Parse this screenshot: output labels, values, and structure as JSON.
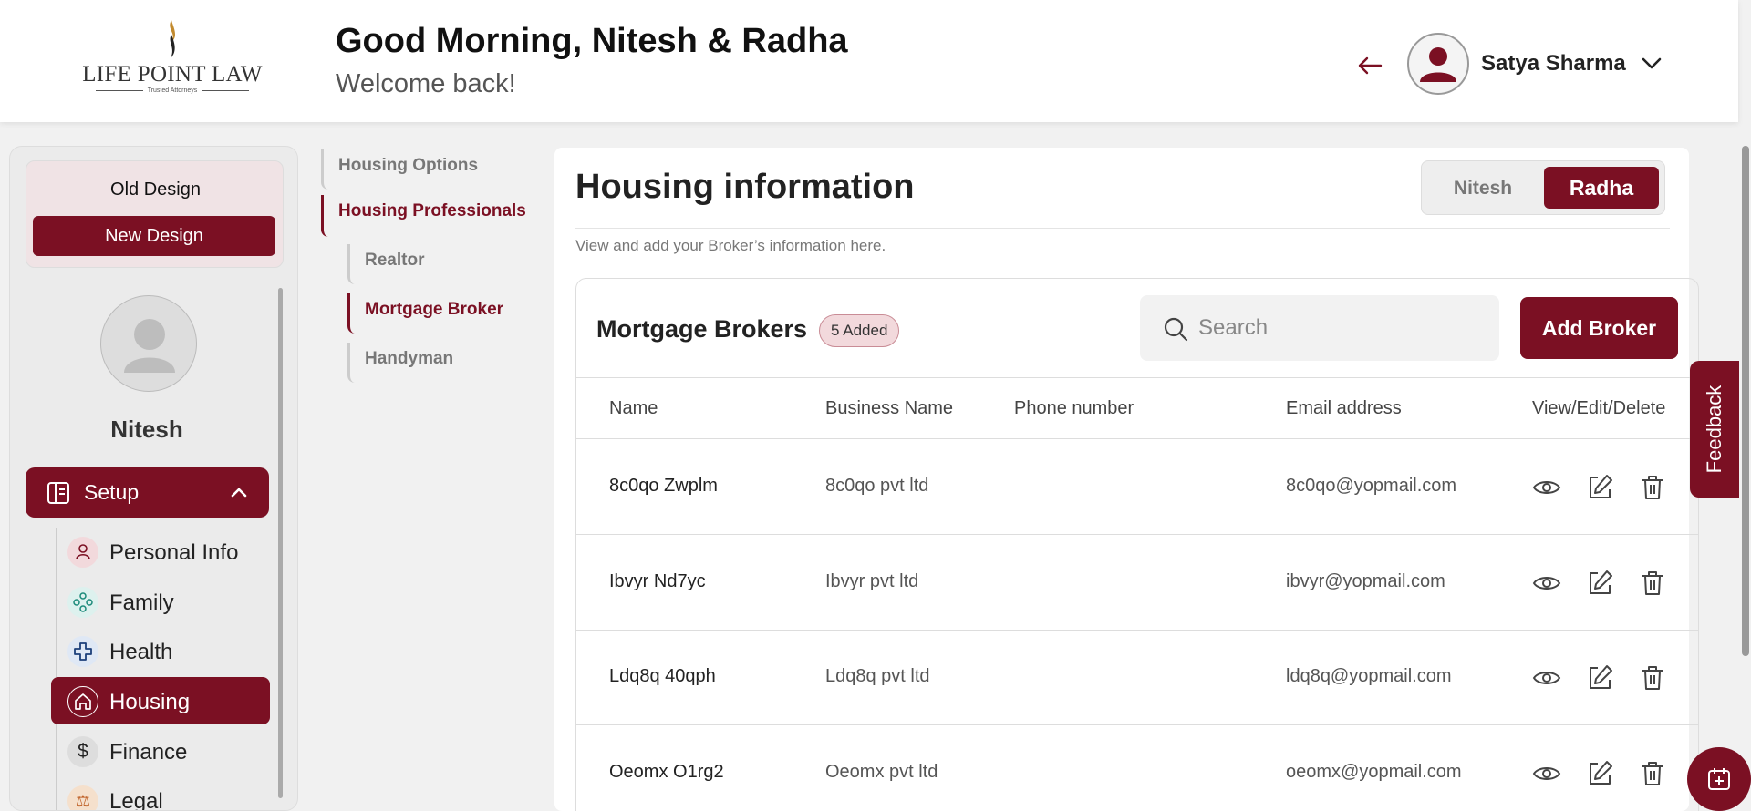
{
  "header": {
    "logo_text": "LIFE POINT LAW",
    "logo_sub": "Trusted Attorneys",
    "greeting": "Good Morning, Nitesh & Radha",
    "welcome": "Welcome back!",
    "user_name": "Satya Sharma"
  },
  "sidebar": {
    "old_design": "Old Design",
    "new_design": "New Design",
    "profile_name": "Nitesh",
    "setup_label": "Setup",
    "items": [
      {
        "label": "Personal Info",
        "icon": "person-icon"
      },
      {
        "label": "Family",
        "icon": "family-icon"
      },
      {
        "label": "Health",
        "icon": "health-cross-icon"
      },
      {
        "label": "Housing",
        "icon": "house-icon",
        "active": true
      },
      {
        "label": "Finance",
        "icon": "dollar-icon"
      },
      {
        "label": "Legal",
        "icon": "legal-icon"
      }
    ]
  },
  "subnav": {
    "housing_options": "Housing Options",
    "housing_professionals": "Housing Professionals",
    "realtor": "Realtor",
    "mortgage_broker": "Mortgage Broker",
    "handyman": "Handyman"
  },
  "main": {
    "title": "Housing information",
    "subtitle": "View and add your Broker’s information here.",
    "toggle": [
      "Nitesh",
      "Radha"
    ],
    "active_toggle": "Radha",
    "section_title": "Mortgage Brokers",
    "badge": "5 Added",
    "search_placeholder": "Search",
    "add_button": "Add Broker",
    "columns": [
      "Name",
      "Business Name",
      "Phone number",
      "Email address",
      "View/Edit/Delete"
    ],
    "rows": [
      {
        "name": "8c0qo Zwplm",
        "business": "8c0qo pvt ltd",
        "phone": "",
        "email": "8c0qo@yopmail.com"
      },
      {
        "name": "Ibvyr Nd7yc",
        "business": "Ibvyr pvt ltd",
        "phone": "",
        "email": "ibvyr@yopmail.com"
      },
      {
        "name": "Ldq8q 40qph",
        "business": "Ldq8q pvt ltd",
        "phone": "",
        "email": "ldq8q@yopmail.com"
      },
      {
        "name": "Oeomx O1rg2",
        "business": "Oeomx pvt ltd",
        "phone": "",
        "email": "oeomx@yopmail.com"
      }
    ]
  },
  "feedback": "Feedback",
  "colors": {
    "brand": "#7b1023",
    "badge_bg": "#f2d9dc"
  }
}
